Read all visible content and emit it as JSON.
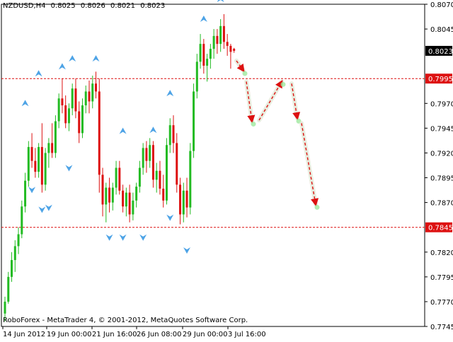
{
  "header": {
    "symbol": "NZDUSD,H4",
    "open": "0.8025",
    "high": "0.8026",
    "low": "0.8021",
    "close": "0.8023"
  },
  "footer": {
    "caption": "RoboForex - MetaTrader 4, © 2001-2012, MetaQuotes Software Corp."
  },
  "colors": {
    "bull": "#22bb22",
    "bear": "#dd1111",
    "level_line": "#dd1111",
    "forecast_arrow": "#dd1111",
    "fractal_marker": "#4da3e6",
    "background": "#ffffff",
    "axis": "#000000"
  },
  "chart_data": {
    "type": "candlestick",
    "ylim": [
      0.7745,
      0.807
    ],
    "y_ticks": [
      "0.8070",
      "0.8045",
      "0.7970",
      "0.7945",
      "0.7920",
      "0.7895",
      "0.7870",
      "0.7820",
      "0.7795",
      "0.7770",
      "0.7745"
    ],
    "x_ticks": [
      "14 Jun 2012",
      "19 Jun 00:00",
      "21 Jun 16:00",
      "26 Jun 08:00",
      "29 Jun 00:00",
      "3 Jul 16:00"
    ],
    "current_price": "0.8023",
    "levels": [
      {
        "label": "0.7995",
        "value": 0.7995
      },
      {
        "label": "0.7845",
        "value": 0.7845
      }
    ],
    "candles": [
      [
        0.7758,
        0.7775,
        0.775,
        0.777
      ],
      [
        0.777,
        0.78,
        0.7768,
        0.7795
      ],
      [
        0.7795,
        0.782,
        0.779,
        0.7812
      ],
      [
        0.7812,
        0.7832,
        0.78,
        0.7826
      ],
      [
        0.7826,
        0.7845,
        0.7818,
        0.7838
      ],
      [
        0.7838,
        0.7872,
        0.7834,
        0.7866
      ],
      [
        0.7866,
        0.79,
        0.786,
        0.7892
      ],
      [
        0.7892,
        0.7932,
        0.7886,
        0.7926
      ],
      [
        0.7926,
        0.794,
        0.7905,
        0.7912
      ],
      [
        0.7912,
        0.7925,
        0.7895,
        0.7901
      ],
      [
        0.7901,
        0.793,
        0.7895,
        0.7926
      ],
      [
        0.7926,
        0.795,
        0.788,
        0.7888
      ],
      [
        0.7888,
        0.7925,
        0.7882,
        0.792
      ],
      [
        0.792,
        0.7935,
        0.7905,
        0.793
      ],
      [
        0.793,
        0.795,
        0.7915,
        0.792
      ],
      [
        0.792,
        0.7958,
        0.7915,
        0.7952
      ],
      [
        0.7952,
        0.798,
        0.7945,
        0.7975
      ],
      [
        0.7975,
        0.7995,
        0.796,
        0.7968
      ],
      [
        0.7968,
        0.7978,
        0.7945,
        0.795
      ],
      [
        0.795,
        0.797,
        0.7942,
        0.7965
      ],
      [
        0.7965,
        0.799,
        0.7958,
        0.7985
      ],
      [
        0.7985,
        0.7995,
        0.7955,
        0.7962
      ],
      [
        0.7962,
        0.7972,
        0.793,
        0.794
      ],
      [
        0.794,
        0.7975,
        0.7935,
        0.7968
      ],
      [
        0.7968,
        0.7988,
        0.796,
        0.7982
      ],
      [
        0.7982,
        0.7993,
        0.796,
        0.7972
      ],
      [
        0.7972,
        0.7998,
        0.7965,
        0.799
      ],
      [
        0.799,
        0.8002,
        0.7975,
        0.7982
      ],
      [
        0.7982,
        0.7995,
        0.788,
        0.7898
      ],
      [
        0.7898,
        0.7905,
        0.7856,
        0.7868
      ],
      [
        0.7868,
        0.789,
        0.785,
        0.7885
      ],
      [
        0.7885,
        0.7895,
        0.786,
        0.787
      ],
      [
        0.787,
        0.789,
        0.7862,
        0.7885
      ],
      [
        0.7885,
        0.7912,
        0.7878,
        0.7905
      ],
      [
        0.7905,
        0.7912,
        0.7878,
        0.7882
      ],
      [
        0.7882,
        0.7888,
        0.786,
        0.7866
      ],
      [
        0.7866,
        0.7885,
        0.7856,
        0.788
      ],
      [
        0.788,
        0.7888,
        0.785,
        0.7858
      ],
      [
        0.7858,
        0.788,
        0.7852,
        0.7872
      ],
      [
        0.7872,
        0.789,
        0.7865,
        0.7886
      ],
      [
        0.7886,
        0.7912,
        0.788,
        0.7905
      ],
      [
        0.7905,
        0.793,
        0.7898,
        0.7925
      ],
      [
        0.7925,
        0.7932,
        0.79,
        0.7912
      ],
      [
        0.7912,
        0.7935,
        0.7905,
        0.7928
      ],
      [
        0.7928,
        0.7932,
        0.7885,
        0.7893
      ],
      [
        0.7893,
        0.791,
        0.788,
        0.7902
      ],
      [
        0.7902,
        0.7912,
        0.7878,
        0.7884
      ],
      [
        0.7884,
        0.7898,
        0.7865,
        0.7872
      ],
      [
        0.7872,
        0.7935,
        0.7868,
        0.7928
      ],
      [
        0.7928,
        0.7955,
        0.792,
        0.7948
      ],
      [
        0.7948,
        0.7958,
        0.792,
        0.793
      ],
      [
        0.793,
        0.794,
        0.788,
        0.7888
      ],
      [
        0.7888,
        0.7895,
        0.7848,
        0.7858
      ],
      [
        0.7858,
        0.789,
        0.785,
        0.7882
      ],
      [
        0.7882,
        0.7895,
        0.7855,
        0.7865
      ],
      [
        0.7865,
        0.793,
        0.7858,
        0.7922
      ],
      [
        0.7922,
        0.799,
        0.7915,
        0.7982
      ],
      [
        0.7982,
        0.802,
        0.7975,
        0.8012
      ],
      [
        0.8012,
        0.804,
        0.8005,
        0.803
      ],
      [
        0.803,
        0.8035,
        0.8,
        0.8008
      ],
      [
        0.8008,
        0.802,
        0.7992,
        0.8015
      ],
      [
        0.8015,
        0.803,
        0.8005,
        0.8025
      ],
      [
        0.8025,
        0.8045,
        0.8015,
        0.8038
      ],
      [
        0.8038,
        0.8045,
        0.802,
        0.803
      ],
      [
        0.803,
        0.8055,
        0.8022,
        0.8048
      ],
      [
        0.8048,
        0.806,
        0.8025,
        0.8032
      ],
      [
        0.8032,
        0.804,
        0.8018,
        0.8028
      ],
      [
        0.8028,
        0.803,
        0.8005,
        0.8022
      ],
      [
        0.8025,
        0.8026,
        0.8021,
        0.8023
      ]
    ],
    "fractals_up": [
      [
        6,
        0.7965
      ],
      [
        10,
        0.7995
      ],
      [
        17,
        0.8002
      ],
      [
        20,
        0.801
      ],
      [
        27,
        0.801
      ],
      [
        35,
        0.7937
      ],
      [
        44,
        0.7938
      ],
      [
        49,
        0.7975
      ],
      [
        59,
        0.805
      ],
      [
        64,
        0.807
      ]
    ],
    "fractals_down": [
      [
        8,
        0.7888
      ],
      [
        11,
        0.7868
      ],
      [
        13,
        0.787
      ],
      [
        19,
        0.791
      ],
      [
        31,
        0.784
      ],
      [
        35,
        0.784
      ],
      [
        41,
        0.784
      ],
      [
        49,
        0.786
      ],
      [
        54,
        0.7827
      ]
    ],
    "forecast_path": [
      [
        0.8013,
        0.8003
      ],
      [
        0.7992,
        0.7952
      ],
      [
        0.7953,
        0.7992
      ],
      [
        0.799,
        0.7955
      ],
      [
        0.795,
        0.7868
      ]
    ]
  }
}
